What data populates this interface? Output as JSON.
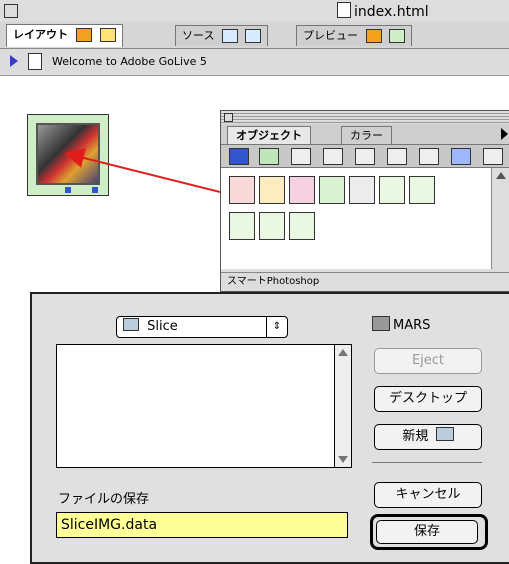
{
  "window": {
    "title": "index.html"
  },
  "tabs": [
    {
      "label": "レイアウト"
    },
    {
      "label": "ソース"
    },
    {
      "label": "プレビュー"
    }
  ],
  "doc_header": {
    "text": "Welcome to Adobe GoLive 5"
  },
  "palette": {
    "tabs": [
      {
        "label": "オブジェクト"
      },
      {
        "label": "カラー"
      }
    ],
    "status": "スマートPhotoshop",
    "icon_names": [
      "page-icon",
      "page-icon",
      "page-icon",
      "page-icon",
      "hand-icon",
      "number-icon",
      "component-icon",
      "question-icon",
      "question-icon",
      "action-icon"
    ]
  },
  "dialog": {
    "folder_popup": "Slice",
    "volume_name": "MARS",
    "buttons": {
      "eject": "Eject",
      "desktop": "デスクトップ",
      "new": "新規",
      "cancel": "キャンセル",
      "save": "保存"
    },
    "save_label": "ファイルの保存",
    "filename": "SliceIMG.data"
  },
  "colors": {
    "highlight": "#ffff99",
    "arrow": "#e21b1b",
    "image_frame": "#cfeec8"
  }
}
